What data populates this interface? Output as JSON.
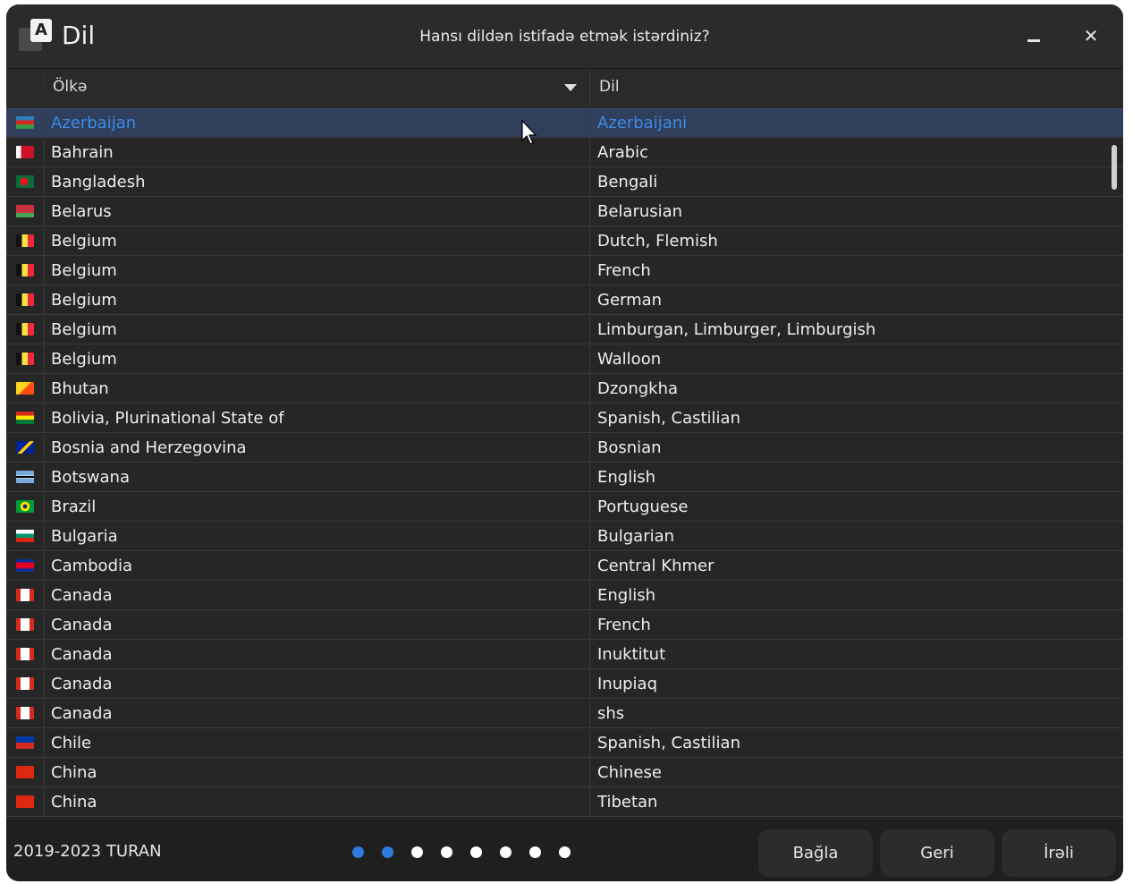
{
  "window": {
    "title": "Dil",
    "icon_letter": "A",
    "subtitle": "Hansı dildən istifadə etmək istərdiniz?",
    "minimize_icon": "minimize-icon",
    "close_glyph": "✕"
  },
  "table": {
    "columns": {
      "country": "Ölkə",
      "language": "Dil"
    },
    "rows": [
      {
        "flag": "az",
        "country": "Azerbaijan",
        "language": "Azerbaijani",
        "selected": true
      },
      {
        "flag": "bh",
        "country": "Bahrain",
        "language": "Arabic"
      },
      {
        "flag": "bd",
        "country": "Bangladesh",
        "language": "Bengali"
      },
      {
        "flag": "by",
        "country": "Belarus",
        "language": "Belarusian"
      },
      {
        "flag": "be",
        "country": "Belgium",
        "language": "Dutch, Flemish"
      },
      {
        "flag": "be",
        "country": "Belgium",
        "language": "French"
      },
      {
        "flag": "be",
        "country": "Belgium",
        "language": "German"
      },
      {
        "flag": "be",
        "country": "Belgium",
        "language": "Limburgan, Limburger, Limburgish"
      },
      {
        "flag": "be",
        "country": "Belgium",
        "language": "Walloon"
      },
      {
        "flag": "bt",
        "country": "Bhutan",
        "language": "Dzongkha"
      },
      {
        "flag": "bo",
        "country": "Bolivia, Plurinational State of",
        "language": "Spanish, Castilian"
      },
      {
        "flag": "ba",
        "country": "Bosnia and Herzegovina",
        "language": "Bosnian"
      },
      {
        "flag": "bw",
        "country": "Botswana",
        "language": "English"
      },
      {
        "flag": "br",
        "country": "Brazil",
        "language": "Portuguese"
      },
      {
        "flag": "bg",
        "country": "Bulgaria",
        "language": "Bulgarian"
      },
      {
        "flag": "kh",
        "country": "Cambodia",
        "language": "Central Khmer"
      },
      {
        "flag": "ca",
        "country": "Canada",
        "language": "English"
      },
      {
        "flag": "ca",
        "country": "Canada",
        "language": "French"
      },
      {
        "flag": "ca",
        "country": "Canada",
        "language": "Inuktitut"
      },
      {
        "flag": "ca",
        "country": "Canada",
        "language": "Inupiaq"
      },
      {
        "flag": "ca",
        "country": "Canada",
        "language": "shs"
      },
      {
        "flag": "cl",
        "country": "Chile",
        "language": "Spanish, Castilian"
      },
      {
        "flag": "cn",
        "country": "China",
        "language": "Chinese"
      },
      {
        "flag": "cn",
        "country": "China",
        "language": "Tibetan"
      }
    ]
  },
  "footer": {
    "copyright": "2019-2023 TURAN",
    "steps_total": 8,
    "steps_completed": 2,
    "buttons": {
      "close": "Bağla",
      "back": "Geri",
      "next": "İrəli"
    }
  },
  "colors": {
    "background": "#262626",
    "selection": "#2f3f5c",
    "accent": "#3d8be8",
    "active_dot": "#2f7be0"
  }
}
